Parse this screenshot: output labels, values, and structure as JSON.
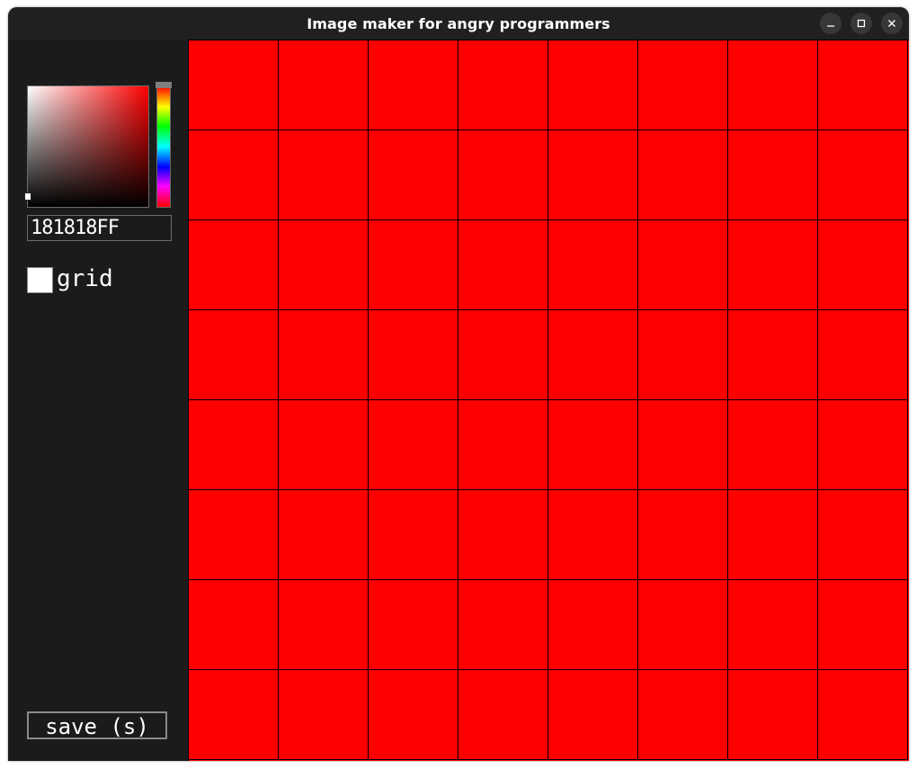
{
  "window": {
    "title": "Image maker for angry programmers"
  },
  "window_controls": {
    "minimize_icon": "minimize-icon",
    "maximize_icon": "maximize-icon",
    "close_icon": "close-icon"
  },
  "color_picker": {
    "hue_color": "#FF0000",
    "hex_value": "181818FF"
  },
  "options": {
    "grid_label": "grid",
    "grid_checked": true
  },
  "actions": {
    "save_label": "save (s)"
  },
  "canvas": {
    "columns": 8,
    "rows": 8,
    "fill_color": "#FF0000",
    "grid_line_color": "#000000"
  }
}
